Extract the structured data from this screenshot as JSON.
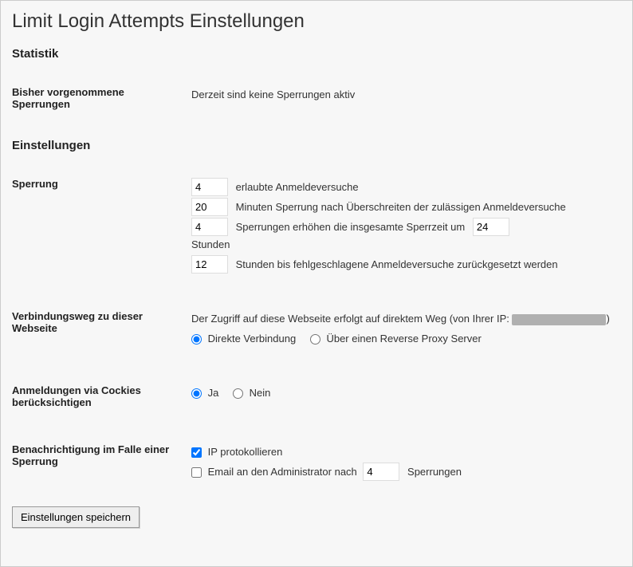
{
  "page_title": "Limit Login Attempts Einstellungen",
  "sections": {
    "stats_heading": "Statistik",
    "settings_heading": "Einstellungen"
  },
  "stats": {
    "lockouts_label": "Bisher vorgenommene Sperrungen",
    "lockouts_value": "Derzeit sind keine Sperrungen aktiv"
  },
  "lockout": {
    "label": "Sperrung",
    "allowed_retries": "4",
    "allowed_retries_text": "erlaubte Anmeldeversuche",
    "lockout_minutes": "20",
    "lockout_minutes_text": "Minuten Sperrung nach Überschreiten der zulässigen Anmeldeversuche",
    "increase_after": "4",
    "increase_text_left": "Sperrungen erhöhen die insgesamte Sperrzeit um",
    "increase_hours": "24",
    "increase_text_right": "Stunden",
    "reset_hours": "12",
    "reset_text": "Stunden bis fehlgeschlagene Anmeldeversuche zurückgesetzt werden"
  },
  "connection": {
    "label": "Verbindungsweg zu dieser Webseite",
    "info_prefix": "Der Zugriff auf diese Webseite erfolgt auf direktem Weg (von Ihrer IP:",
    "info_suffix": ")",
    "direct_label": "Direkte Verbindung",
    "proxy_label": "Über einen Reverse Proxy Server",
    "selected": "direct"
  },
  "cookies": {
    "label": "Anmeldungen via Cockies berücksichtigen",
    "yes_label": "Ja",
    "no_label": "Nein",
    "selected": "yes"
  },
  "notify": {
    "label": "Benachrichtigung im Falle einer Sperrung",
    "log_ip_label": "IP protokollieren",
    "log_ip_checked": true,
    "email_label_left": "Email an den Administrator nach",
    "email_threshold": "4",
    "email_label_right": "Sperrungen",
    "email_checked": false
  },
  "submit": {
    "label": "Einstellungen speichern"
  }
}
